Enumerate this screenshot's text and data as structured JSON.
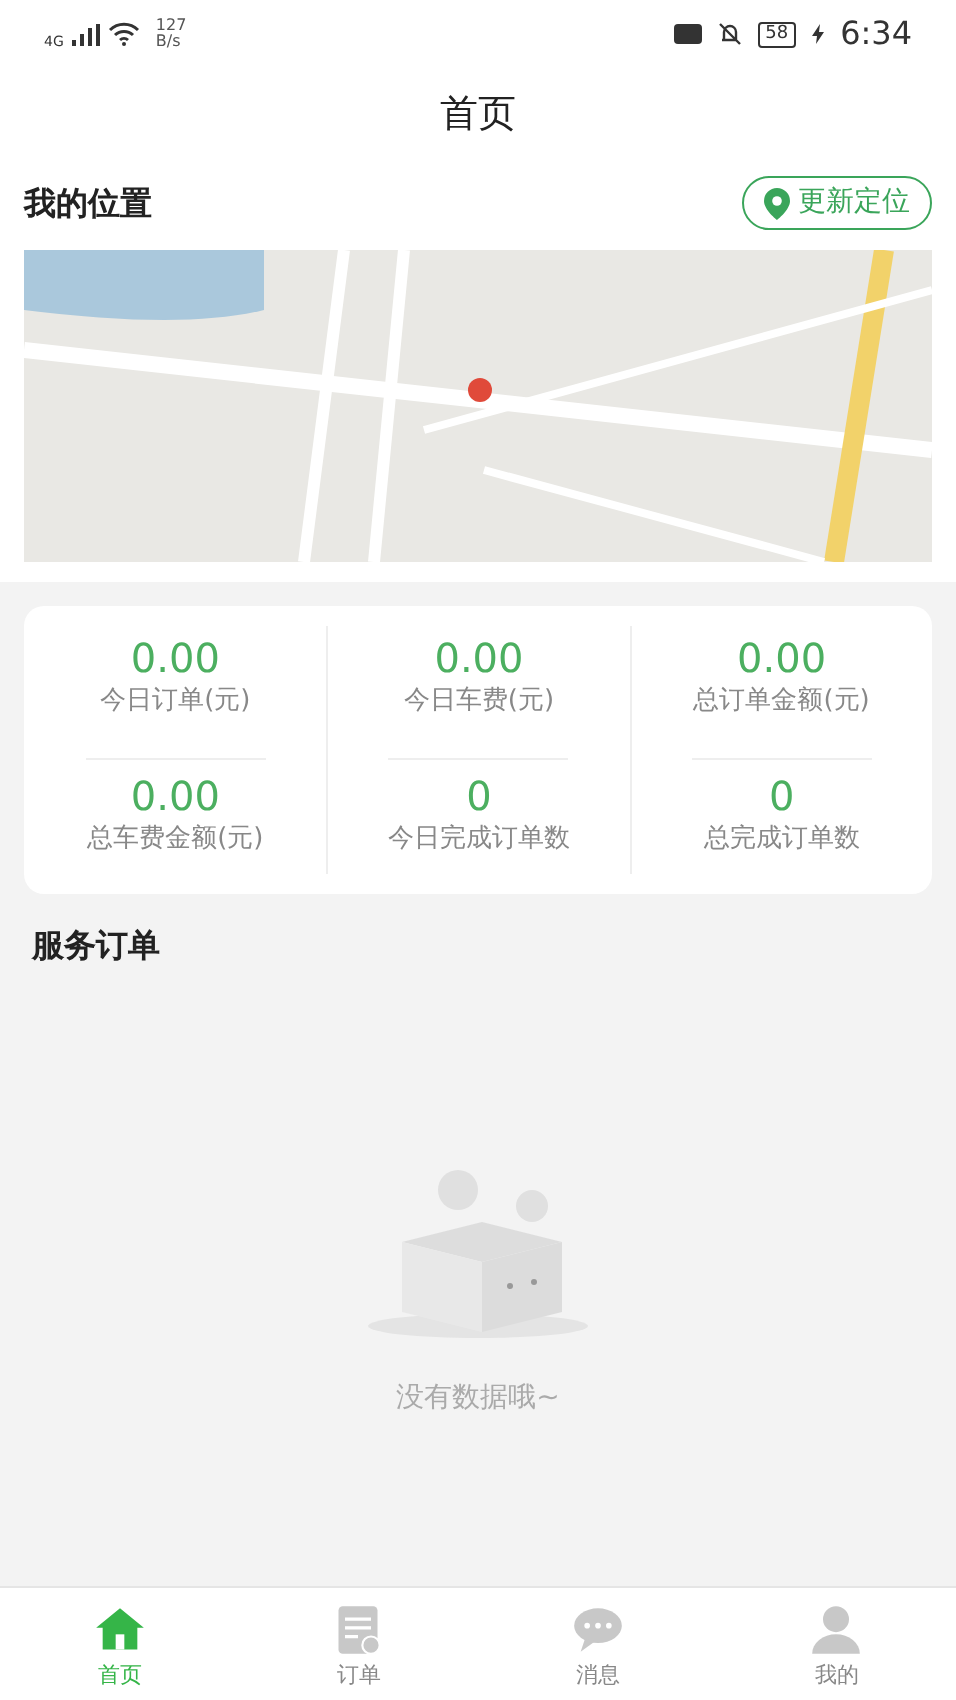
{
  "status_bar": {
    "network": "4G",
    "speed": "127\nB/s",
    "battery": "58",
    "time": "6:34"
  },
  "title": "首页",
  "location": {
    "heading": "我的位置",
    "button": "更新定位"
  },
  "stats": [
    {
      "value": "0.00",
      "label": "今日订单(元)"
    },
    {
      "value": "0.00",
      "label": "今日车费(元)"
    },
    {
      "value": "0.00",
      "label": "总订单金额(元)"
    },
    {
      "value": "0.00",
      "label": "总车费金额(元)"
    },
    {
      "value": "0",
      "label": "今日完成订单数"
    },
    {
      "value": "0",
      "label": "总完成订单数"
    }
  ],
  "orders": {
    "heading": "服务订单",
    "empty_text": "没有数据哦~"
  },
  "tabs": [
    {
      "label": "首页",
      "kind": "home",
      "selected": true
    },
    {
      "label": "订单",
      "kind": "orders",
      "selected": false
    },
    {
      "label": "消息",
      "kind": "messages",
      "selected": false
    },
    {
      "label": "我的",
      "kind": "profile",
      "selected": false
    }
  ]
}
